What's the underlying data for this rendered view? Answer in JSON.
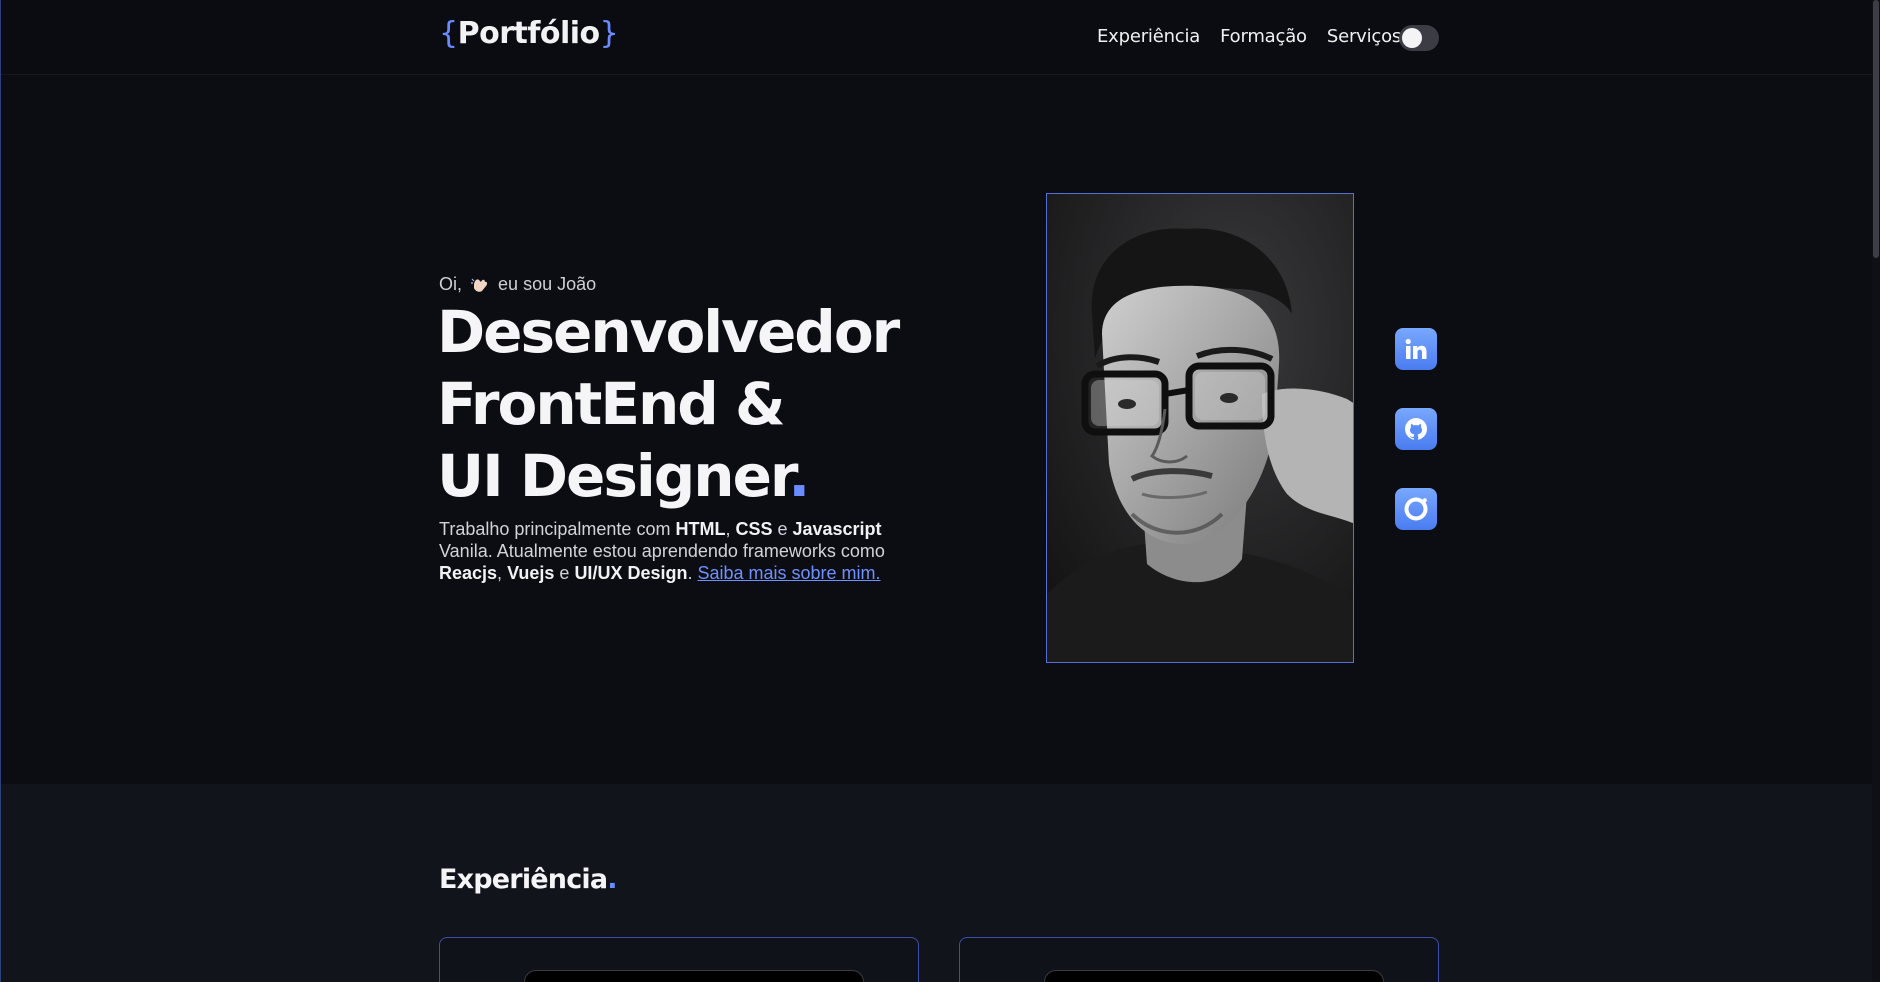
{
  "header": {
    "logo_brace_open": "{",
    "logo_text": "Portfólio",
    "logo_brace_close": "}",
    "nav": [
      {
        "label": "Experiência"
      },
      {
        "label": "Formação"
      },
      {
        "label": "Serviços"
      }
    ],
    "theme_toggle": {
      "state": "off"
    }
  },
  "hero": {
    "greeting_prefix": "Oi,",
    "greeting_suffix": "eu sou João",
    "headline_line1": "Desenvolvedor",
    "headline_line2": "FrontEnd &",
    "headline_line3": "UI Designer",
    "headline_dot": ".",
    "intro": {
      "t1": "Trabalho principalmente com ",
      "b1": "HTML",
      "t2": ", ",
      "b2": "CSS",
      "t3": " e ",
      "b3": "Javascript",
      "t4": " Vanila. Atualmente estou aprendendo frameworks como ",
      "b4": "Reacjs",
      "t5": ", ",
      "b5": "Vuejs",
      "t6": " e ",
      "b6": "UI/UX Design",
      "t7": ". ",
      "link": "Saiba mais sobre mim."
    }
  },
  "social": [
    {
      "icon": "linkedin-icon"
    },
    {
      "icon": "github-icon"
    },
    {
      "icon": "instagram-icon"
    }
  ],
  "experience": {
    "title": "Experiência",
    "dot": "."
  },
  "colors": {
    "accent": "#6b8cff",
    "background": "#0c0d12",
    "section_background": "#12141c"
  }
}
